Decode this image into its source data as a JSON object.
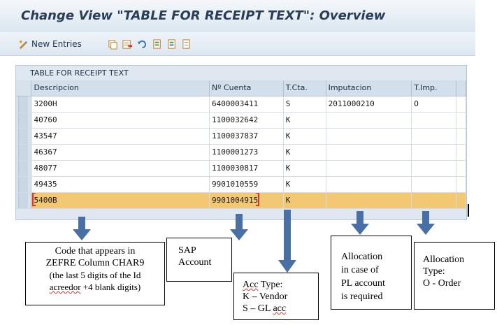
{
  "window": {
    "title": "Change View \"TABLE FOR RECEIPT TEXT\": Overview"
  },
  "toolbar": {
    "new_entries_label": "New Entries",
    "icons": [
      "display-change-icon",
      "copy-icon",
      "delete-icon",
      "undo-icon",
      "select-all-icon",
      "select-block-icon",
      "deselect-all-icon"
    ]
  },
  "table": {
    "title": "TABLE FOR RECEIPT TEXT",
    "columns": [
      "Descripcion",
      "Nº Cuenta",
      "T.Cta.",
      "Imputacion",
      "T.Imp."
    ],
    "rows": [
      [
        "3200H",
        "6400003411",
        "S",
        "2011000210",
        "O"
      ],
      [
        "40760",
        "1100032642",
        "K",
        "",
        ""
      ],
      [
        "43547",
        "1100037837",
        "K",
        "",
        ""
      ],
      [
        "46367",
        "1100001273",
        "K",
        "",
        ""
      ],
      [
        "48077",
        "1100030817",
        "K",
        "",
        ""
      ],
      [
        "49435",
        "9901010559",
        "K",
        "",
        ""
      ],
      [
        "5400B",
        "9901004915",
        "K",
        "",
        ""
      ]
    ],
    "highlight_color": "#f2c872"
  },
  "notes": {
    "descripcion": [
      "Code that appears in",
      "ZEFRE Column CHAR9",
      "(the last 5 digits of the Id",
      "acreedor +4 blank digits)"
    ],
    "cuenta": [
      "SAP",
      "Account"
    ],
    "tcta": [
      "Acc Type:",
      "K – Vendor",
      "S – GL acc"
    ],
    "imputacion": [
      "Allocation",
      "in case of",
      "PL account",
      "is required"
    ],
    "timp": [
      "Allocation",
      "Type:",
      "O - Order"
    ]
  },
  "colors": {
    "arrow": "#4a6fa5",
    "title": "#2a3e58"
  }
}
